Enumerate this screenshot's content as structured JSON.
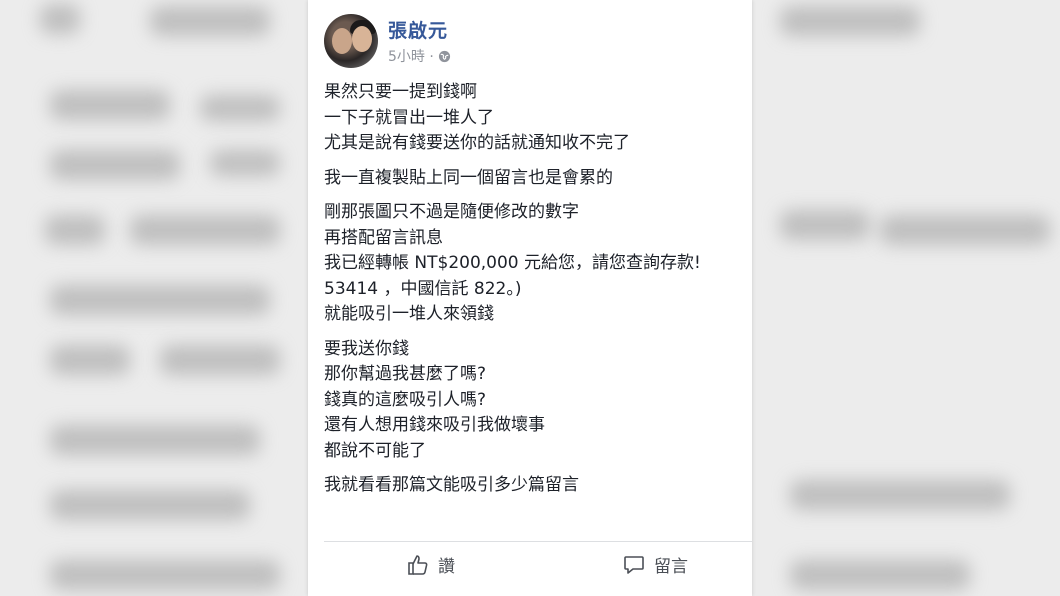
{
  "post": {
    "author": "張啟元",
    "time": "5小時 ·",
    "paragraphs": [
      [
        "果然只要一提到錢啊",
        "一下子就冒出一堆人了",
        "尤其是說有錢要送你的話就通知收不完了"
      ],
      [
        "我一直複製貼上同一個留言也是會累的"
      ],
      [
        "剛那張圖只不過是隨便修改的數字",
        "再搭配留言訊息",
        "我已經轉帳 NT$200,000 元給您，請您查詢存款!",
        "53414 ，中國信託 822。)",
        "就能吸引一堆人來領錢"
      ],
      [
        "要我送你錢",
        "那你幫過我甚麼了嗎?",
        "錢真的這麼吸引人嗎?",
        "還有人想用錢來吸引我做壞事",
        "都說不可能了"
      ],
      [
        "我就看看那篇文能吸引多少篇留言"
      ]
    ]
  },
  "actions": {
    "like_label": "讚",
    "comment_label": "留言"
  },
  "icons": {
    "audience": "globe-icon",
    "like": "thumbs-up-icon",
    "comment": "comment-bubble-icon"
  },
  "colors": {
    "author_link": "#365899",
    "meta": "#90949c",
    "text": "#1d2129"
  }
}
